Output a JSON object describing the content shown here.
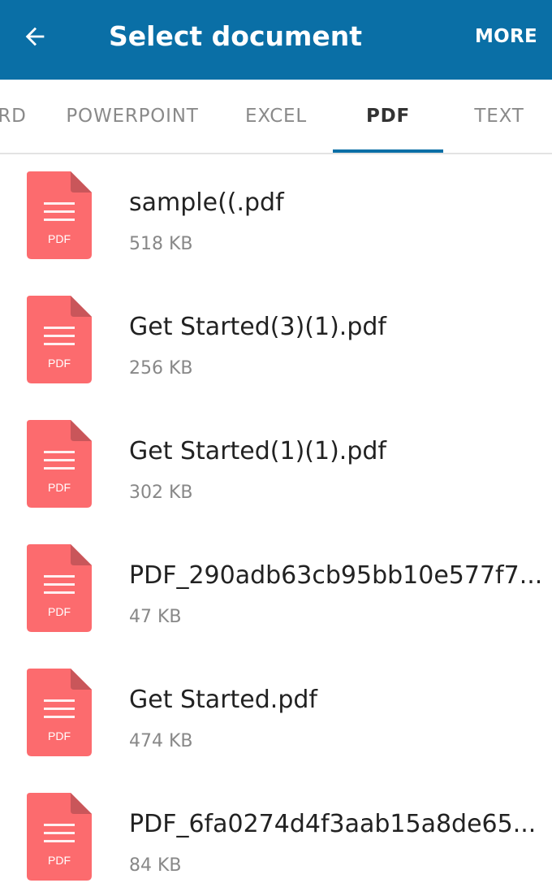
{
  "appbar": {
    "title": "Select document",
    "more_label": "MORE",
    "back_icon": "arrow-left-icon",
    "color": "#0a6fa6"
  },
  "tabs": [
    {
      "label": "RD",
      "active": false
    },
    {
      "label": "POWERPOINT",
      "active": false
    },
    {
      "label": "EXCEL",
      "active": false
    },
    {
      "label": "PDF",
      "active": true
    },
    {
      "label": "TEXT",
      "active": false
    }
  ],
  "file_icon": {
    "label": "PDF",
    "icon": "pdf-file-icon",
    "color": "#fc6b6e",
    "fold_color": "#c9565a"
  },
  "files": [
    {
      "name": "sample((.pdf",
      "size": "518 KB"
    },
    {
      "name": "Get Started(3)(1).pdf",
      "size": "256 KB"
    },
    {
      "name": "Get Started(1)(1).pdf",
      "size": "302 KB"
    },
    {
      "name": "PDF_290adb63cb95bb10e577f7...",
      "size": "47 KB"
    },
    {
      "name": "Get Started.pdf",
      "size": "474 KB"
    },
    {
      "name": "PDF_6fa0274d4f3aab15a8de65...",
      "size": "84 KB"
    }
  ]
}
